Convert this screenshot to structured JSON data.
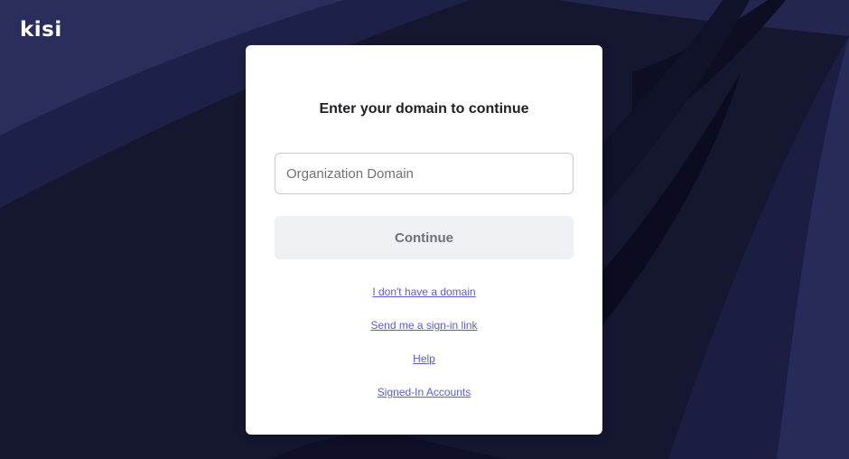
{
  "brand": {
    "logo_text": "kisi"
  },
  "card": {
    "title": "Enter your domain to continue",
    "domain_input": {
      "value": "",
      "placeholder": "Organization Domain"
    },
    "continue_label": "Continue"
  },
  "links": [
    {
      "label": "I don't have a domain"
    },
    {
      "label": "Send me a sign-in link"
    },
    {
      "label": "Help"
    },
    {
      "label": "Signed-In Accounts"
    }
  ],
  "colors": {
    "background": "#1a1d3c",
    "link": "#5a5bd6",
    "button_bg": "#eef0f4",
    "button_text": "#6e7079"
  }
}
